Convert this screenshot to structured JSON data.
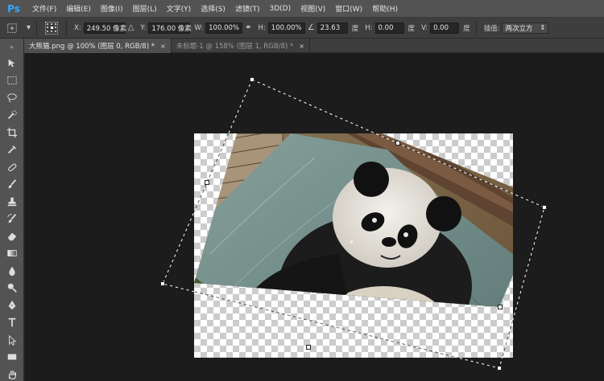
{
  "app": {
    "logo": "Ps",
    "menu": [
      "文件(F)",
      "编辑(E)",
      "图像(I)",
      "图层(L)",
      "文字(Y)",
      "选择(S)",
      "滤镜(T)",
      "3D(D)",
      "视图(V)",
      "窗口(W)",
      "帮助(H)"
    ]
  },
  "options": {
    "x_label": "X:",
    "x_value": "249.50 像素",
    "y_label": "Y:",
    "y_value": "176.00 像素",
    "w_label": "W:",
    "w_value": "100.00%",
    "h_label": "H:",
    "h_value": "100.00%",
    "angle_value": "23.63",
    "angle_unit": "度",
    "hskew_label": "H:",
    "hskew_value": "0.00",
    "hskew_unit": "度",
    "vskew_label": "V:",
    "vskew_value": "0.00",
    "vskew_unit": "度",
    "interp_label": "插值:",
    "interp_value": "两次立方"
  },
  "tabs": [
    {
      "label": "大熊猫.png @ 100% (图层 0, RGB/8) *",
      "close": "×",
      "active": true
    },
    {
      "label": "未标题-1 @ 158% (图层 1, RGB/8) *",
      "close": "×",
      "active": false
    }
  ],
  "tools": [
    "move-tool",
    "marquee-tool",
    "lasso-tool",
    "quick-selection-tool",
    "crop-tool",
    "eyedropper-tool",
    "healing-brush-tool",
    "brush-tool",
    "clone-stamp-tool",
    "history-brush-tool",
    "eraser-tool",
    "gradient-tool",
    "blur-tool",
    "dodge-tool",
    "pen-tool",
    "type-tool",
    "path-selection-tool",
    "rectangle-tool",
    "hand-tool"
  ],
  "colors": {
    "menubar": "#535353",
    "optbar": "#3e3e3e",
    "canvas": "#1c1c1c",
    "accent": "#31a8ff"
  },
  "canvas": {
    "transform_angle_deg": 23.63,
    "subject": "giant panda in hammock"
  }
}
